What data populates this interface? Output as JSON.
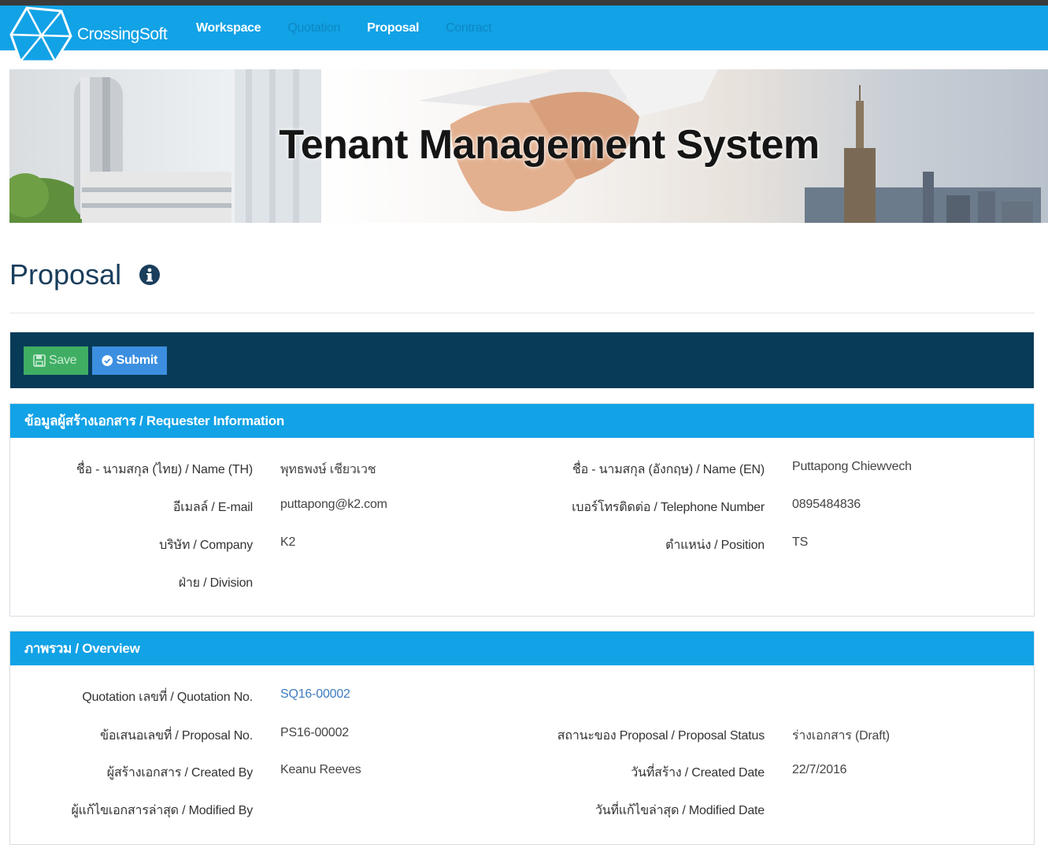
{
  "app": {
    "brand": "CrossingSoft",
    "nav": [
      {
        "label": "Workspace",
        "state": "active"
      },
      {
        "label": "Quotation",
        "state": "muted"
      },
      {
        "label": "Proposal",
        "state": "active"
      },
      {
        "label": "Contract",
        "state": "muted"
      }
    ]
  },
  "banner": {
    "title": "Tenant Management System"
  },
  "page": {
    "title": "Proposal",
    "info_icon": "info-circle-icon"
  },
  "toolbar": {
    "save_label": "Save",
    "submit_label": "Submit"
  },
  "requester": {
    "heading": "ข้อมูลผู้สร้างเอกสาร / Requester Information",
    "fields": {
      "name_th_label": "ชื่อ - นามสกุล (ไทย) / Name (TH)",
      "name_th_value": "พุทธพงษ์ เชียวเวช",
      "name_en_label": "ชื่อ - นามสกุล (อังกฤษ) / Name (EN)",
      "name_en_value": "Puttapong Chiewvech",
      "email_label": "อีเมลล์ / E-mail",
      "email_value": "puttapong@k2.com",
      "phone_label": "เบอร์โทรติดต่อ / Telephone Number",
      "phone_value": "0895484836",
      "company_label": "บริษัท / Company",
      "company_value": "K2",
      "position_label": "ตำแหน่ง / Position",
      "position_value": "TS",
      "division_label": "ฝ่าย / Division",
      "division_value": ""
    }
  },
  "overview": {
    "heading": "ภาพรวม / Overview",
    "fields": {
      "quotation_no_label": "Quotation เลขที่ / Quotation No.",
      "quotation_no_value": "SQ16-00002",
      "proposal_no_label": "ข้อเสนอเลขที่ / Proposal No.",
      "proposal_no_value": "PS16-00002",
      "proposal_status_label": "สถานะของ Proposal / Proposal Status",
      "proposal_status_value": "ร่างเอกสาร (Draft)",
      "created_by_label": "ผู้สร้างเอกสาร / Created By",
      "created_by_value": "Keanu Reeves",
      "created_date_label": "วันที่สร้าง / Created Date",
      "created_date_value": "22/7/2016",
      "modified_by_label": "ผู้แก้ไขเอกสารล่าสุด / Modified By",
      "modified_by_value": "",
      "modified_date_label": "วันที่แก้ไขล่าสุด / Modified Date",
      "modified_date_value": ""
    }
  }
}
